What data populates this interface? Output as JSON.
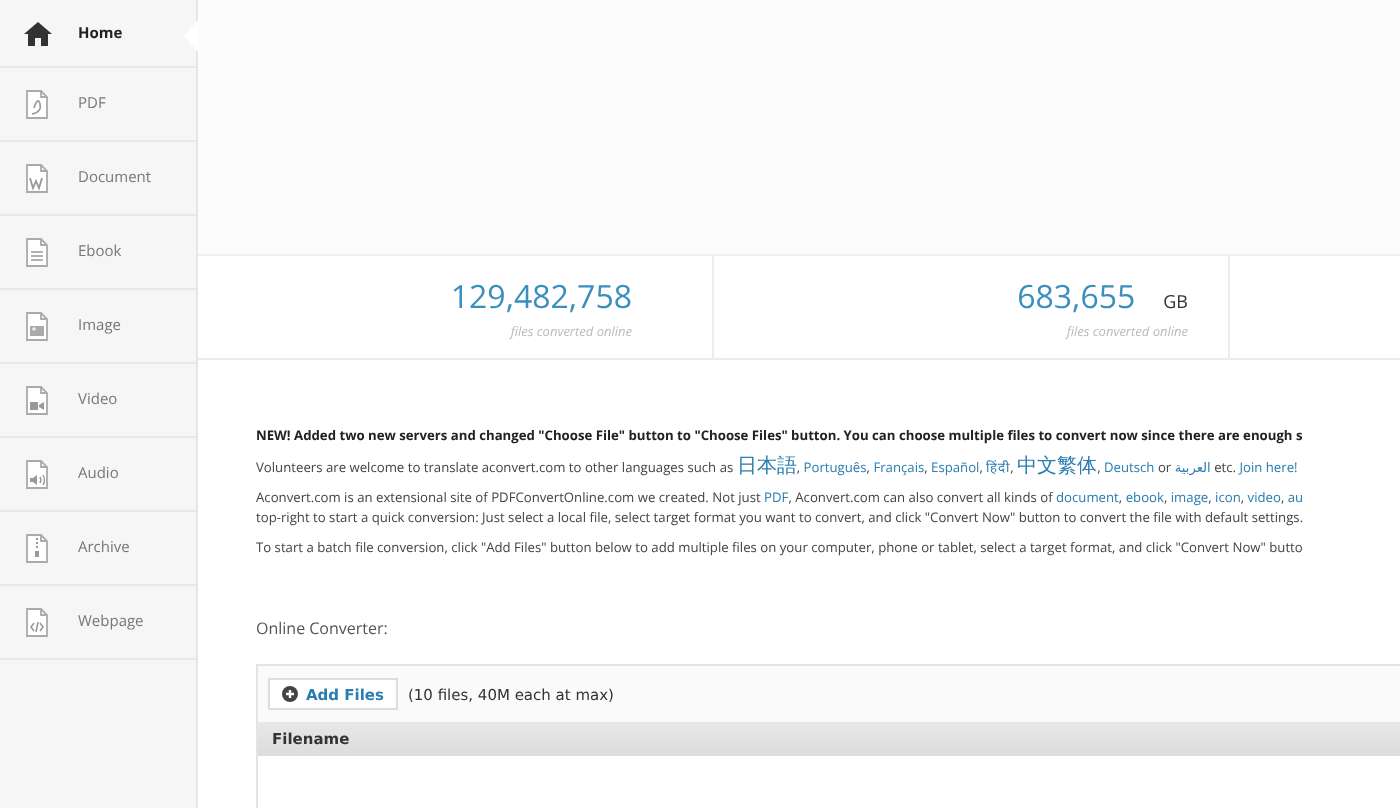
{
  "sidebar": {
    "items": [
      {
        "label": "Home",
        "kind": "home",
        "selected": true
      },
      {
        "label": "PDF",
        "kind": "pdf",
        "selected": false
      },
      {
        "label": "Document",
        "kind": "document",
        "selected": false
      },
      {
        "label": "Ebook",
        "kind": "ebook",
        "selected": false
      },
      {
        "label": "Image",
        "kind": "image",
        "selected": false
      },
      {
        "label": "Video",
        "kind": "video",
        "selected": false
      },
      {
        "label": "Audio",
        "kind": "audio",
        "selected": false
      },
      {
        "label": "Archive",
        "kind": "archive",
        "selected": false
      },
      {
        "label": "Webpage",
        "kind": "webpage",
        "selected": false
      }
    ]
  },
  "stats": [
    {
      "value": "129,482,758",
      "caption": "files converted online"
    },
    {
      "value": "683,655",
      "unit": "GB",
      "caption": "files converted online"
    }
  ],
  "notices": [
    {
      "kind": "bold",
      "lines": [
        [
          {
            "text": "NEW! Added two new servers and changed \"Choose File\" button to \"Choose Files\" button. You can choose multiple files to convert now since there are enough s",
            "link": false
          }
        ]
      ]
    },
    {
      "kind": "plain",
      "lines": [
        [
          {
            "text": "Volunteers are welcome to translate aconvert.com to other languages such as ",
            "link": false
          },
          {
            "text": "日本語",
            "link": true
          },
          {
            "text": ", ",
            "link": false
          },
          {
            "text": "Português",
            "link": true
          },
          {
            "text": ", ",
            "link": false
          },
          {
            "text": "Français",
            "link": true
          },
          {
            "text": ", ",
            "link": false
          },
          {
            "text": "Español",
            "link": true
          },
          {
            "text": ", ",
            "link": false
          },
          {
            "text": "हिंदी",
            "link": true
          },
          {
            "text": ", ",
            "link": false
          },
          {
            "text": "中文繁体",
            "link": true
          },
          {
            "text": ", ",
            "link": false
          },
          {
            "text": "Deutsch",
            "link": true
          },
          {
            "text": " or ",
            "link": false
          },
          {
            "text": "العربية",
            "link": true
          },
          {
            "text": " etc. ",
            "link": false
          },
          {
            "text": "Join here!",
            "link": true
          }
        ]
      ]
    },
    {
      "kind": "plain",
      "lines": [
        [
          {
            "text": "Aconvert.com is an extensional site of PDFConvertOnline.com we created. Not just ",
            "link": false
          },
          {
            "text": "PDF",
            "link": true
          },
          {
            "text": ", Aconvert.com can also convert all kinds of ",
            "link": false
          },
          {
            "text": "document",
            "link": true
          },
          {
            "text": ", ",
            "link": false
          },
          {
            "text": "ebook",
            "link": true
          },
          {
            "text": ", ",
            "link": false
          },
          {
            "text": "image",
            "link": true
          },
          {
            "text": ", ",
            "link": false
          },
          {
            "text": "icon",
            "link": true
          },
          {
            "text": ", ",
            "link": false
          },
          {
            "text": "video",
            "link": true
          },
          {
            "text": ", ",
            "link": false
          },
          {
            "text": "au",
            "link": true
          }
        ],
        [
          {
            "text": "top-right to start a quick conversion: Just select a local file, select target format you want to convert, and click \"Convert Now\" button to convert the file with default settings.",
            "link": false
          }
        ]
      ]
    },
    {
      "kind": "plain",
      "lines": [
        [
          {
            "text": "To start a batch file conversion, click \"Add Files\" button below to add multiple files on your computer, phone or tablet, select a target format, and click \"Convert Now\" butto",
            "link": false
          }
        ]
      ]
    }
  ],
  "converter": {
    "title": "Online Converter:",
    "add_button": "Add Files",
    "limit": "(10 files, 40M each at max)",
    "columns": [
      "Filename"
    ]
  }
}
